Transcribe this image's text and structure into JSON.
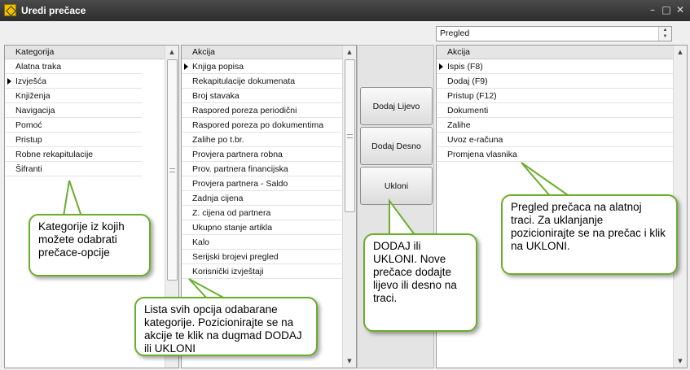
{
  "window": {
    "title": "Uredi prečace",
    "controls": [
      "–",
      "□",
      "✕"
    ]
  },
  "category_panel": {
    "header": "Kategorija",
    "items": [
      {
        "label": "Alatna traka",
        "selected": false
      },
      {
        "label": "Izvješća",
        "selected": true
      },
      {
        "label": "Knjiženja",
        "selected": false
      },
      {
        "label": "Navigacija",
        "selected": false
      },
      {
        "label": "Pomoć",
        "selected": false
      },
      {
        "label": "Pristup",
        "selected": false
      },
      {
        "label": "Robne rekapitulacije",
        "selected": false
      },
      {
        "label": "Šifranti",
        "selected": false
      }
    ]
  },
  "action_panel": {
    "header": "Akcija",
    "items": [
      {
        "label": "Knjiga popisa",
        "selected": true
      },
      {
        "label": "Rekapitulacije dokumenata",
        "selected": false
      },
      {
        "label": "Broj stavaka",
        "selected": false
      },
      {
        "label": "Raspored poreza periodični",
        "selected": false
      },
      {
        "label": "Raspored poreza po dokumentima",
        "selected": false
      },
      {
        "label": "Zalihe po t.br.",
        "selected": false
      },
      {
        "label": "Provjera partnera robna",
        "selected": false
      },
      {
        "label": "Prov. partnera financijska",
        "selected": false
      },
      {
        "label": "Provjera partnera - Saldo",
        "selected": false
      },
      {
        "label": "Zadnja cijena",
        "selected": false
      },
      {
        "label": "Z. cijena od partnera",
        "selected": false
      },
      {
        "label": "Ukupno stanje artikla",
        "selected": false
      },
      {
        "label": "Kalo",
        "selected": false
      },
      {
        "label": "Serijski brojevi pregled",
        "selected": false
      },
      {
        "label": "Korisnički izvještaji",
        "selected": false
      }
    ]
  },
  "buttons": {
    "add_left": "Dodaj Lijevo",
    "add_right": "Dodaj Desno",
    "remove": "Ukloni"
  },
  "preview_dropdown": {
    "value": "Pregled"
  },
  "preview_panel": {
    "header": "Akcija",
    "items": [
      {
        "label": "Ispis (F8)",
        "selected": true
      },
      {
        "label": "Dodaj (F9)",
        "selected": false
      },
      {
        "label": "Pristup (F12)",
        "selected": false
      },
      {
        "label": "Dokumenti",
        "selected": false
      },
      {
        "label": "Zalihe",
        "selected": false
      },
      {
        "label": "Uvoz e-računa",
        "selected": false
      },
      {
        "label": "Promjena vlasnika",
        "selected": false
      }
    ]
  },
  "callouts": {
    "categories": "Kategorije iz kojih možete odabrati prečace-opcije",
    "actions": "Lista svih opcija odabarane kategorije. Pozicionirajte se na akcije te klik na dugmad DODAJ ili UKLONI",
    "add_remove": "DODAJ ili UKLONI. Nove prečace dodajte lijevo ili desno na traci.",
    "preview": "Pregled prečaca na alatnoj traci. Za uklanjanje pozicionirajte se na prečac i klik na UKLONI."
  },
  "colors": {
    "callout_border": "#6cad2d",
    "titlebar": "#3a3a3a"
  }
}
